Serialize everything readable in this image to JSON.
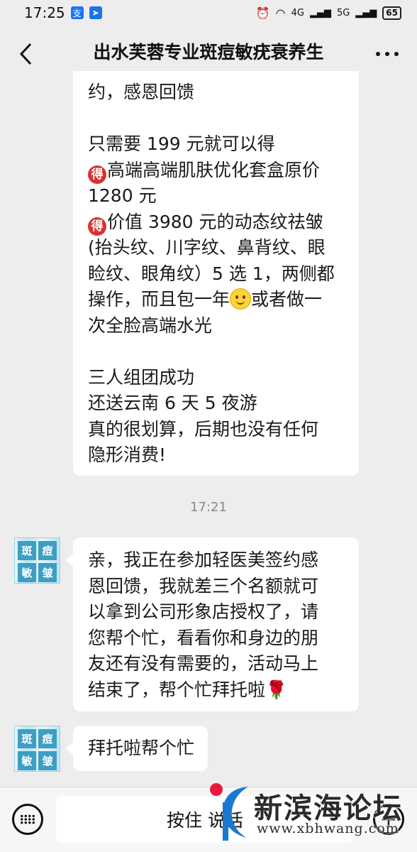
{
  "status_bar": {
    "time": "17:25",
    "net_4g": "4G",
    "net_5g": "5G",
    "battery": "65"
  },
  "header": {
    "title": "出水芙蓉专业斑痘敏疣衰养生",
    "back_icon": "chevron-left-icon",
    "more_icon": "more-dots-icon"
  },
  "messages": {
    "msg1": {
      "lines": [
        "约，感恩回馈",
        "",
        "只需要 199 元就可以得",
        "高端高端肌肤优化套盒原价",
        "1280 元",
        "价值 3980 元的动态纹祛皱",
        "(抬头纹、川字纹、鼻背纹、眼",
        "睑纹、眼角纹）5 选 1，两侧都",
        "操作，而且包一年",
        "或者做一",
        "次全脸高端水光",
        "",
        "三人组团成功",
        "还送云南 6 天 5 夜游",
        "真的很划算，后期也没有任何",
        "隐形消费!"
      ],
      "de_glyph": "得"
    },
    "timestamp": "17:21",
    "msg2": {
      "lines": [
        "亲，我正在参加轻医美签约感",
        "恩回馈，我就差三个名额就可",
        "以拿到公司形象店授权了，请",
        "您帮个忙，看看你和身边的朋",
        "友还有没有需要的，活动马上",
        "结束了，帮个忙拜托啦🌹"
      ]
    },
    "msg3": {
      "text": "拜托啦帮个忙"
    },
    "avatar_chars": [
      "斑",
      "痘",
      "敏",
      "皱"
    ]
  },
  "bottom_bar": {
    "hold_to_talk": "按住 说话",
    "keyboard_icon": "keyboard-icon",
    "plus_icon": "plus-icon"
  },
  "watermark": {
    "title": "新滨海论坛",
    "url": "www.xbhwang.com"
  },
  "colors": {
    "background": "#ededed",
    "bubble": "#ffffff",
    "avatar_blue": "#3c9fc3",
    "emoji_red": "#d9332f"
  }
}
